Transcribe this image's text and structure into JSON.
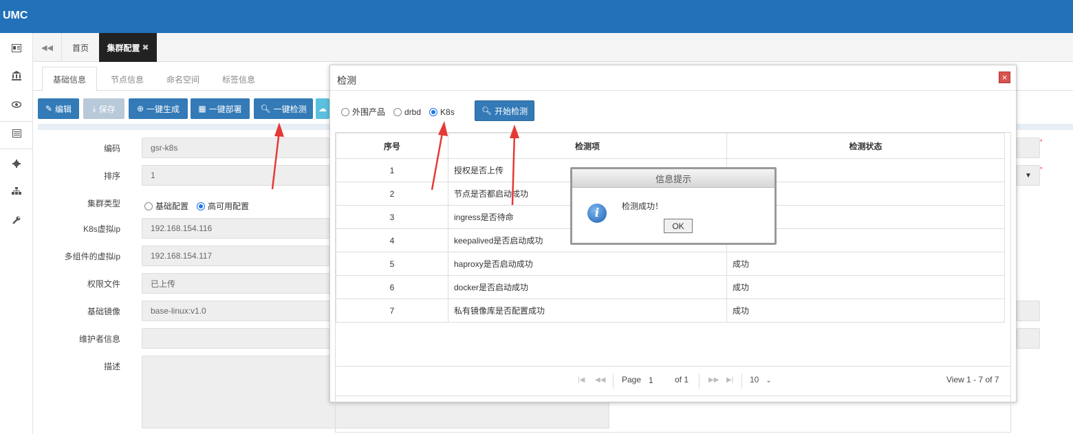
{
  "app": {
    "logo": "UMC"
  },
  "tabbar": {
    "home": "首页",
    "active": "集群配置",
    "close": "✖"
  },
  "subtabs": [
    "基础信息",
    "节点信息",
    "命名空间",
    "标签信息"
  ],
  "toolbar": {
    "edit": "编辑",
    "save": "保存",
    "generate": "一键生成",
    "deploy": "一键部署",
    "detect": "一键检测"
  },
  "form": {
    "code_label": "编码",
    "code_value": "gsr-k8s",
    "order_label": "排序",
    "order_value": "1",
    "type_label": "集群类型",
    "type_opt1": "基础配置",
    "type_opt2": "高可用配置",
    "vip_label": "K8s虚拟ip",
    "vip_value": "192.168.154.116",
    "multi_vip_label": "多组件的虚拟ip",
    "multi_vip_value": "192.168.154.117",
    "auth_label": "权限文件",
    "auth_value": "已上传",
    "image_label": "基础镜像",
    "image_value": "base-linux:v1.0",
    "maintainer_label": "维护者信息",
    "maintainer_value": "",
    "desc_label": "描述"
  },
  "modal": {
    "title": "检测",
    "options": [
      "外围产品",
      "drbd",
      "K8s"
    ],
    "selected": "K8s",
    "start_button": "开始检测",
    "columns": [
      "序号",
      "检测项",
      "检测状态"
    ],
    "rows": [
      {
        "no": "1",
        "item": "授权是否上传",
        "status": ""
      },
      {
        "no": "2",
        "item": "节点是否都启动成功",
        "status": ""
      },
      {
        "no": "3",
        "item": "ingress是否待命",
        "status": ""
      },
      {
        "no": "4",
        "item": "keepalived是否启动成功",
        "status": ""
      },
      {
        "no": "5",
        "item": "haproxy是否启动成功",
        "status": "成功"
      },
      {
        "no": "6",
        "item": "docker是否启动成功",
        "status": "成功"
      },
      {
        "no": "7",
        "item": "私有镜像库是否配置成功",
        "status": "成功"
      }
    ],
    "pager": {
      "page_label": "Page",
      "page_value": "1",
      "of_label": "of 1",
      "page_size": "10",
      "view": "View 1 - 7 of 7"
    }
  },
  "alert": {
    "title": "信息提示",
    "message": "检测成功！",
    "ok": "OK"
  },
  "colors": {
    "topbar": "#2271b9",
    "button": "#337ab7",
    "arrow": "#e53935"
  }
}
